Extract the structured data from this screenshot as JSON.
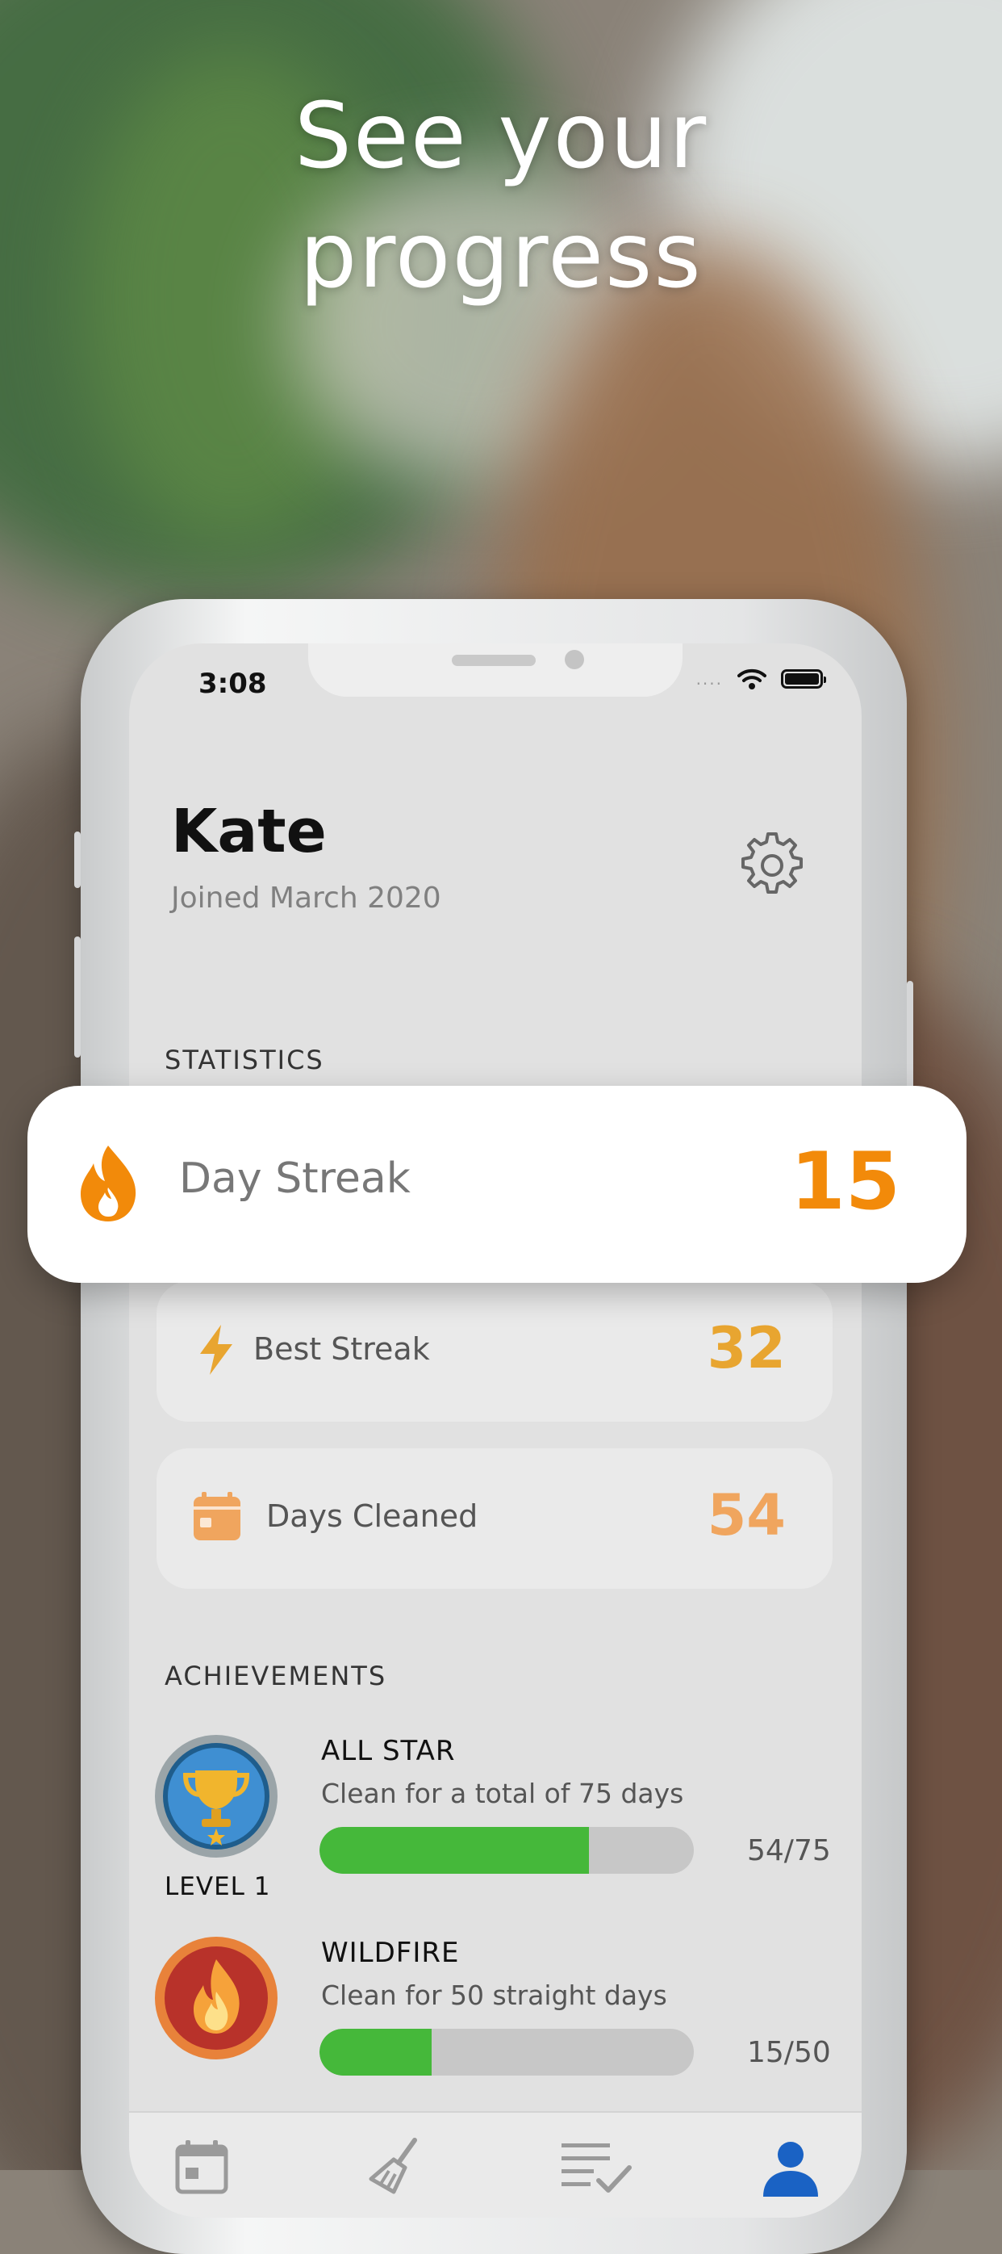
{
  "headline": {
    "line1": "See your",
    "line2": "progress"
  },
  "status_bar": {
    "time": "3:08",
    "signal": "....",
    "wifi_icon": "wifi-icon",
    "battery_icon": "battery-icon"
  },
  "profile": {
    "name": "Kate",
    "joined": "Joined March 2020",
    "settings_icon": "gear-icon"
  },
  "statistics": {
    "label": "STATISTICS",
    "highlight": {
      "label": "Day Streak",
      "value": "15",
      "icon": "flame-icon",
      "color": "#f28a0a"
    },
    "cards": [
      {
        "label": "Best Streak",
        "value": "32",
        "icon": "lightning-icon",
        "color": "#e8a530"
      },
      {
        "label": "Days Cleaned",
        "value": "54",
        "icon": "calendar-icon",
        "color": "#f0a55e"
      }
    ]
  },
  "achievements": {
    "label": "ACHIEVEMENTS",
    "items": [
      {
        "title": "ALL STAR",
        "description": "Clean for a total of 75 days",
        "count": "54/75",
        "progress": 0.72,
        "level": "LEVEL 1",
        "icon": "trophy-badge-icon"
      },
      {
        "title": "WILDFIRE",
        "description": "Clean for 50 straight days",
        "count": "15/50",
        "progress": 0.3,
        "icon": "fire-badge-icon"
      }
    ]
  },
  "tabbar": {
    "tabs": [
      "calendar-tab-icon",
      "brush-tab-icon",
      "checklist-tab-icon",
      "profile-tab-icon"
    ],
    "active_color": "#1a62c4"
  },
  "colors": {
    "progress_green": "#45b83a",
    "accent_orange": "#f28a0a"
  }
}
